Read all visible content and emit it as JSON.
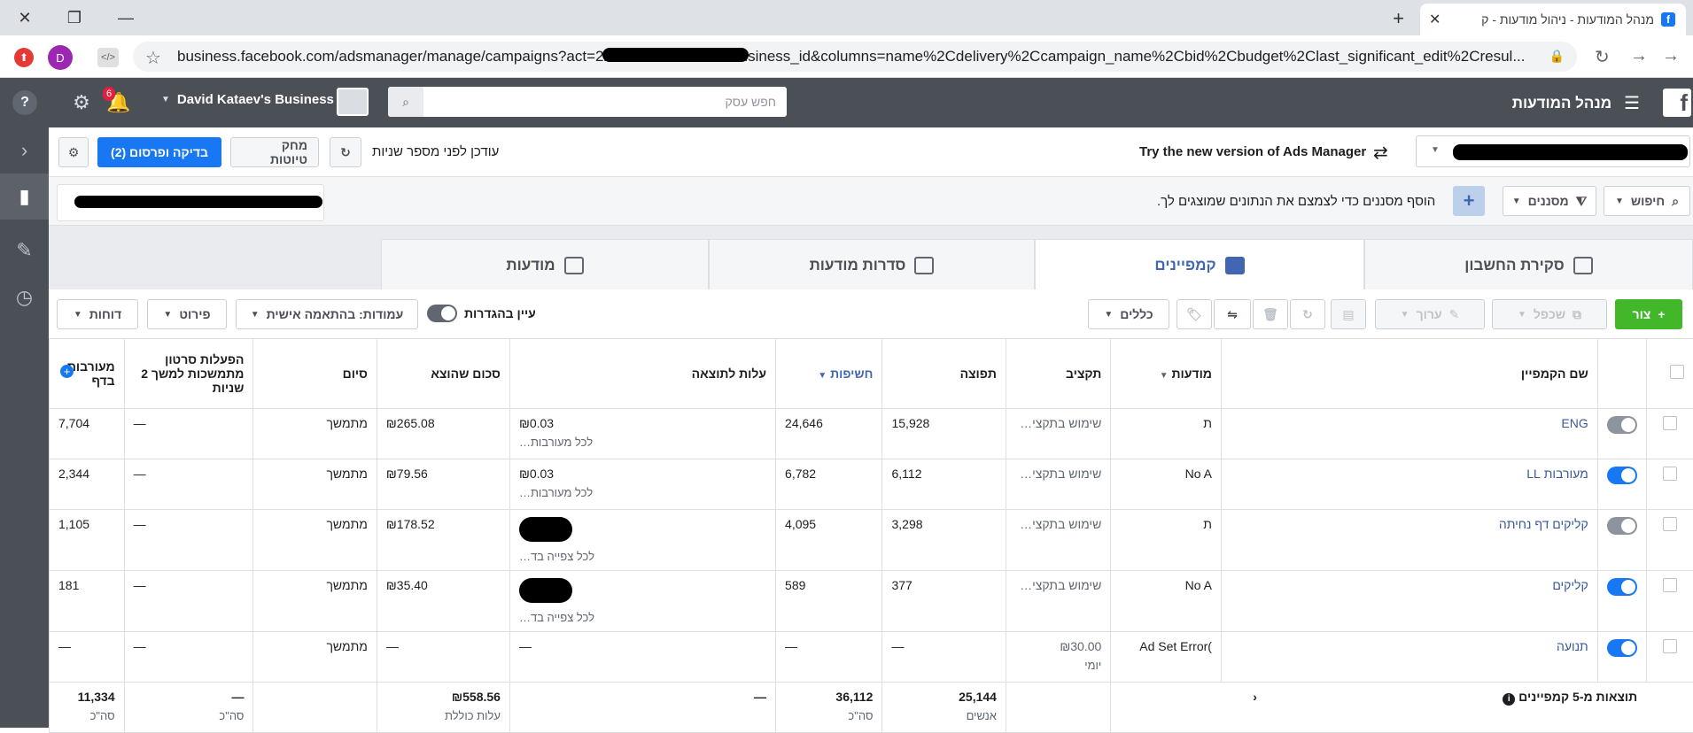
{
  "browser": {
    "tab_title": "מנהל המודעות - ניהול מודעות - ק",
    "fb_letter": "f",
    "tab_close": "✕",
    "new_tab": "+",
    "window_close": "✕",
    "window_restore": "❐",
    "window_min": "—",
    "url": "business.facebook.com/adsmanager/manage/campaigns?act=224497004574358&business_id&columns=name%2Cdelivery%2Ccampaign_name%2Cbid%2Cbudget%2Clast_significant_edit%2Cresul...",
    "ext_profile": "D"
  },
  "header": {
    "app_title": "מנהל המודעות",
    "business_name": "David Kataev's Business",
    "notif_count": "6",
    "search_placeholder": "חפש עסק",
    "fb_logo": "f"
  },
  "toolbar1": {
    "try_new": "Try the new version of Ads Manager",
    "updated": "עודכן לפני מספר שניות",
    "discard": "מחק טיוטות",
    "review": "בדיקה ופרסום (2)"
  },
  "toolbar2": {
    "search": "חיפוש",
    "filters": "מסננים",
    "filter_hint": "הוסף מסננים כדי לצמצם את הנתונים שמוצגים לך."
  },
  "tabs": [
    {
      "label": "סקירת החשבון"
    },
    {
      "label": "קמפיינים"
    },
    {
      "label": "סדרות מודעות"
    },
    {
      "label": "מודעות"
    }
  ],
  "toolbar3": {
    "create": "צור",
    "duplicate": "שכפל",
    "edit": "ערוך",
    "rules": "כללים",
    "view_setup": "עיין בהגדרות",
    "columns_label": "עמודות: בהתאמה אישית",
    "breakdown": "פירוט",
    "reports": "דוחות"
  },
  "table": {
    "headers": {
      "name": "שם הקמפיין",
      "delivery": "מודעות",
      "budget": "תקציב",
      "reach": "תפוצה",
      "impressions": "חשיפות",
      "cost": "עלות לתוצאה",
      "spent": "סכום שהוצא",
      "ends": "סיום",
      "video": "הפעלות סרטון מתמשכות למשך 2 שניות",
      "engagement": "מעורבות בדף"
    },
    "rows": [
      {
        "name": "ENG",
        "delivery": "ת",
        "budget": "שימוש בתקצי…",
        "reach": "15,928",
        "impressions": "24,646",
        "cost": "₪0.03",
        "cost_sub": "לכל מעורבות…",
        "spent": "₪265.08",
        "ends": "מתמשך",
        "video": "—",
        "engagement": "7,704",
        "on": false
      },
      {
        "name": "מעורבות LL",
        "delivery": "No A",
        "budget": "שימוש בתקצי…",
        "reach": "6,112",
        "impressions": "6,782",
        "cost": "₪0.03",
        "cost_sub": "לכל מעורבות…",
        "spent": "₪79.56",
        "ends": "מתמשך",
        "video": "—",
        "engagement": "2,344",
        "on": true
      },
      {
        "name": "קליקים דף נחיתה",
        "delivery": "ת",
        "budget": "שימוש בתקצי…",
        "reach": "3,298",
        "impressions": "4,095",
        "cost": "",
        "cost_sub": "לכל צפייה בד…",
        "spent": "₪178.52",
        "ends": "מתמשך",
        "video": "—",
        "engagement": "1,105",
        "on": false
      },
      {
        "name": "קליקים",
        "delivery": "No A",
        "budget": "שימוש בתקצי…",
        "reach": "377",
        "impressions": "589",
        "cost": "",
        "cost_sub": "לכל צפייה בד…",
        "spent": "₪35.40",
        "ends": "מתמשך",
        "video": "—",
        "engagement": "181",
        "on": true
      },
      {
        "name": "תנועה",
        "delivery": "Ad Set Error(",
        "budget": "₪30.00",
        "budget_sub": "יומי",
        "reach": "—",
        "impressions": "—",
        "cost": "—",
        "cost_sub": "",
        "spent": "—",
        "ends": "מתמשך",
        "video": "—",
        "engagement": "—",
        "on": true
      }
    ],
    "totals": {
      "label": "תוצאות מ-5 קמפיינים",
      "reach": "25,144",
      "reach_sub": "אנשים",
      "impressions": "36,112",
      "impressions_sub": "סה\"כ",
      "cost": "—",
      "spent": "₪558.56",
      "spent_sub": "עלות כוללת",
      "video": "—",
      "video_sub": "סה\"כ",
      "engagement": "11,334",
      "engagement_sub": "סה\"כ"
    }
  }
}
